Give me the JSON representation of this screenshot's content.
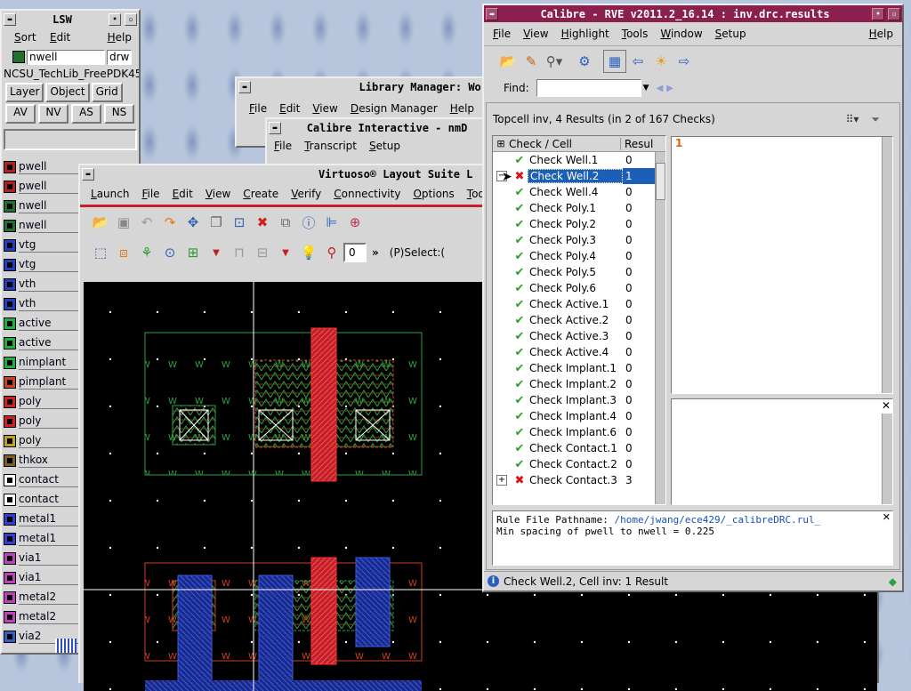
{
  "lsw": {
    "title": "LSW",
    "menu": [
      "Sort",
      "Edit",
      "Help"
    ],
    "current_layer": "nwell",
    "current_purpose": "drw",
    "library": "NCSU_TechLib_FreePDK45",
    "buttons_row1": [
      "Layer",
      "Object",
      "Grid"
    ],
    "buttons_row2": [
      "AV",
      "NV",
      "AS",
      "NS"
    ],
    "layers": [
      {
        "name": "pwell",
        "color": "#b02020"
      },
      {
        "name": "pwell",
        "color": "#b02020"
      },
      {
        "name": "nwell",
        "color": "#207030"
      },
      {
        "name": "nwell",
        "color": "#207030"
      },
      {
        "name": "vtg",
        "color": "#2040c0"
      },
      {
        "name": "vtg",
        "color": "#2040c0"
      },
      {
        "name": "vth",
        "color": "#2040c0"
      },
      {
        "name": "vth",
        "color": "#2040c0"
      },
      {
        "name": "active",
        "color": "#20b040"
      },
      {
        "name": "active",
        "color": "#20b040"
      },
      {
        "name": "nimplant",
        "color": "#20b040"
      },
      {
        "name": "pimplant",
        "color": "#d04020"
      },
      {
        "name": "poly",
        "color": "#d02020"
      },
      {
        "name": "poly",
        "color": "#d02020"
      },
      {
        "name": "poly",
        "color": "#c0a020"
      },
      {
        "name": "thkox",
        "color": "#806020"
      },
      {
        "name": "contact",
        "color": "#ffffff"
      },
      {
        "name": "contact",
        "color": "#ffffff"
      },
      {
        "name": "metal1",
        "color": "#3040d0"
      },
      {
        "name": "metal1",
        "color": "#3040d0"
      },
      {
        "name": "via1",
        "color": "#c040c0"
      },
      {
        "name": "via1",
        "color": "#c040c0"
      },
      {
        "name": "metal2",
        "color": "#c040c0"
      },
      {
        "name": "metal2",
        "color": "#c040c0"
      },
      {
        "name": "via2",
        "color": "#3060c0"
      }
    ]
  },
  "libmgr": {
    "title": "Library Manager: Wor",
    "menu": [
      "File",
      "Edit",
      "View",
      "Design Manager",
      "Help"
    ]
  },
  "calint": {
    "title": "Calibre Interactive - nmD",
    "menu": [
      "File",
      "Transcript",
      "Setup"
    ]
  },
  "virtuoso": {
    "title": "Virtuoso® Layout Suite L",
    "menu": [
      "Launch",
      "File",
      "Edit",
      "View",
      "Create",
      "Verify",
      "Connectivity",
      "Options",
      "Tools"
    ],
    "select_count": "0",
    "select_label": "(P)Select:("
  },
  "rve": {
    "title": "Calibre - RVE v2011.2_16.14 : inv.drc.results",
    "menu": [
      "File",
      "View",
      "Highlight",
      "Tools",
      "Window",
      "Setup"
    ],
    "help": "Help",
    "find_label": "Find:",
    "find_value": "",
    "summary": "Topcell inv, 4 Results (in 2 of 167 Checks)",
    "col_check": "Check / Cell",
    "col_result": "Resul",
    "detail_number": "1",
    "checks": [
      {
        "name": "Check Well.1",
        "count": "0",
        "status": "ok",
        "expand": false,
        "selected": false
      },
      {
        "name": "Check Well.2",
        "count": "1",
        "status": "bad",
        "expand": true,
        "selected": true
      },
      {
        "name": "Check Well.4",
        "count": "0",
        "status": "ok",
        "expand": false,
        "selected": false
      },
      {
        "name": "Check Poly.1",
        "count": "0",
        "status": "ok",
        "expand": false,
        "selected": false
      },
      {
        "name": "Check Poly.2",
        "count": "0",
        "status": "ok",
        "expand": false,
        "selected": false
      },
      {
        "name": "Check Poly.3",
        "count": "0",
        "status": "ok",
        "expand": false,
        "selected": false
      },
      {
        "name": "Check Poly.4",
        "count": "0",
        "status": "ok",
        "expand": false,
        "selected": false
      },
      {
        "name": "Check Poly.5",
        "count": "0",
        "status": "ok",
        "expand": false,
        "selected": false
      },
      {
        "name": "Check Poly.6",
        "count": "0",
        "status": "ok",
        "expand": false,
        "selected": false
      },
      {
        "name": "Check Active.1",
        "count": "0",
        "status": "ok",
        "expand": false,
        "selected": false
      },
      {
        "name": "Check Active.2",
        "count": "0",
        "status": "ok",
        "expand": false,
        "selected": false
      },
      {
        "name": "Check Active.3",
        "count": "0",
        "status": "ok",
        "expand": false,
        "selected": false
      },
      {
        "name": "Check Active.4",
        "count": "0",
        "status": "ok",
        "expand": false,
        "selected": false
      },
      {
        "name": "Check Implant.1",
        "count": "0",
        "status": "ok",
        "expand": false,
        "selected": false
      },
      {
        "name": "Check Implant.2",
        "count": "0",
        "status": "ok",
        "expand": false,
        "selected": false
      },
      {
        "name": "Check Implant.3",
        "count": "0",
        "status": "ok",
        "expand": false,
        "selected": false
      },
      {
        "name": "Check Implant.4",
        "count": "0",
        "status": "ok",
        "expand": false,
        "selected": false
      },
      {
        "name": "Check Implant.6",
        "count": "0",
        "status": "ok",
        "expand": false,
        "selected": false
      },
      {
        "name": "Check Contact.1",
        "count": "0",
        "status": "ok",
        "expand": false,
        "selected": false
      },
      {
        "name": "Check Contact.2",
        "count": "0",
        "status": "ok",
        "expand": false,
        "selected": false
      },
      {
        "name": "Check Contact.3",
        "count": "3",
        "status": "bad",
        "expand": true,
        "selected": false
      }
    ],
    "rule_label": "Rule File Pathname: ",
    "rule_path": "/home/jwang/ece429/_calibreDRC.rul_",
    "rule_text": "Min spacing of pwell to nwell = 0.225",
    "status": "Check Well.2, Cell inv: 1 Result"
  }
}
